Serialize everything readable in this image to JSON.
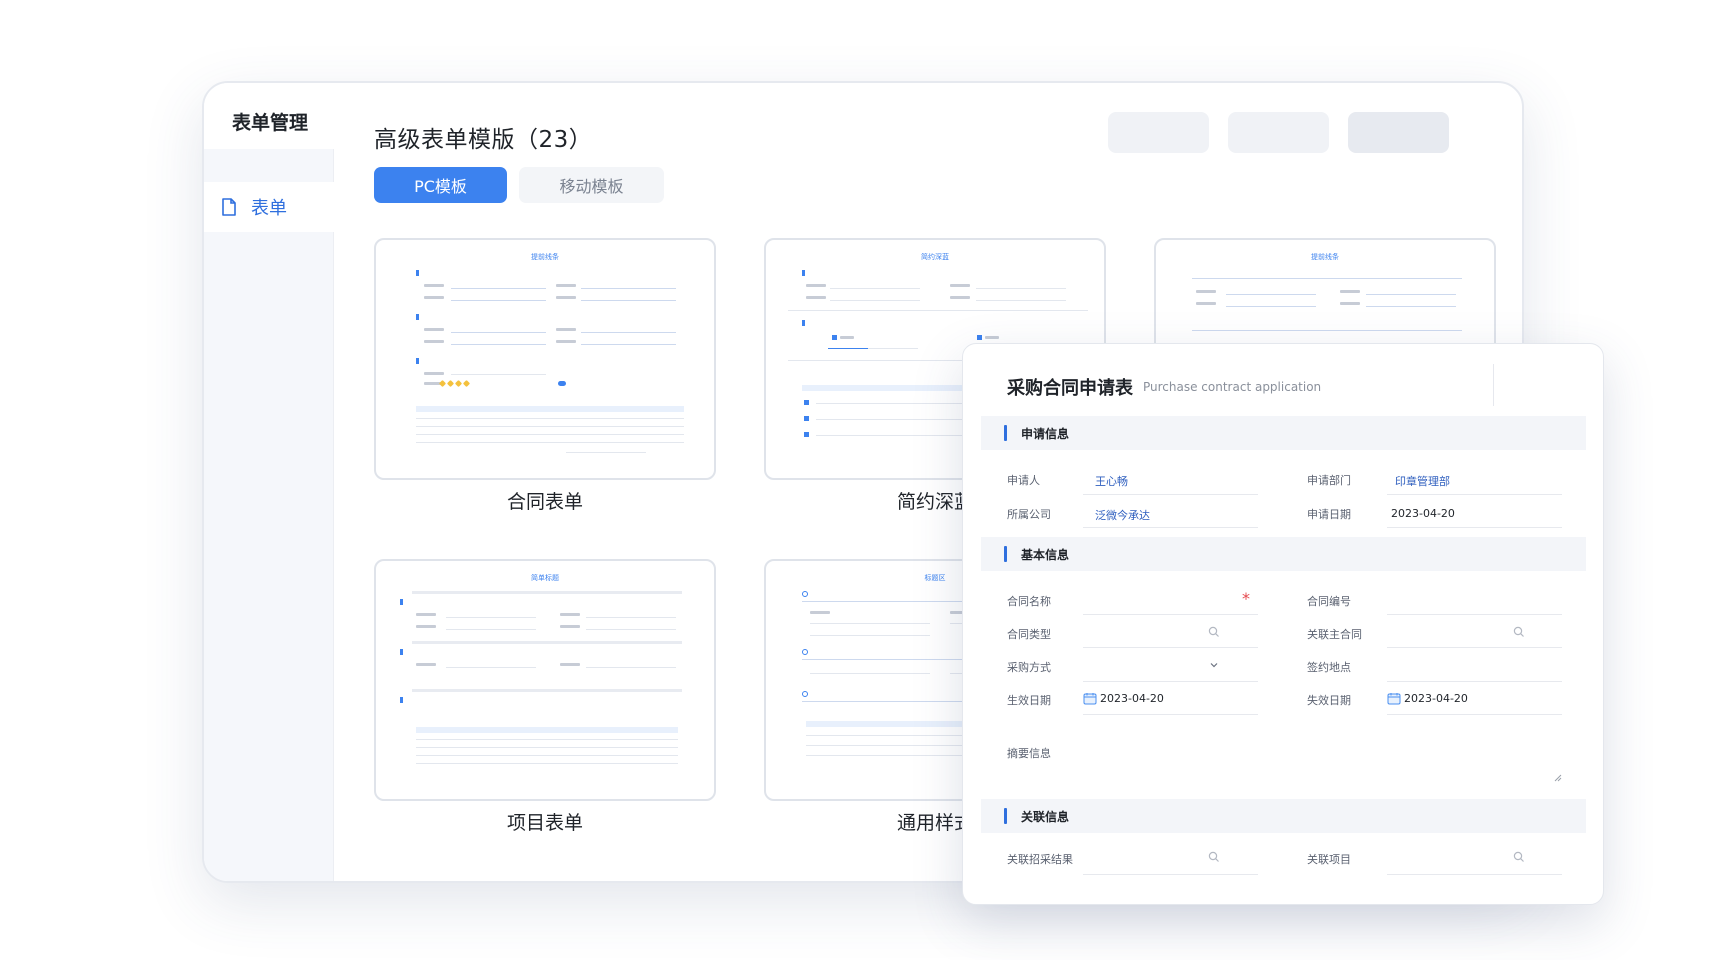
{
  "sidebar": {
    "title": "表单管理",
    "items": [
      {
        "label": "表单",
        "icon": "file-icon"
      }
    ]
  },
  "header": {
    "title": "高级表单模版（23）"
  },
  "tabs": [
    {
      "label": "PC模板",
      "active": true
    },
    {
      "label": "移动模板",
      "active": false
    }
  ],
  "templates": [
    {
      "label": "合同表单",
      "thumb_title": "提前线条"
    },
    {
      "label": "简约深蓝",
      "thumb_title": "简约深蓝"
    },
    {
      "label": "",
      "thumb_title": "提前线条"
    },
    {
      "label": "项目表单",
      "thumb_title": "简单标题"
    },
    {
      "label": "通用样式",
      "thumb_title": "标题区"
    }
  ],
  "form": {
    "title": "采购合同申请表",
    "subtitle": "Purchase contract application",
    "sections": {
      "apply": "申请信息",
      "basic": "基本信息",
      "related": "关联信息"
    },
    "fields": {
      "applicant": {
        "label": "申请人",
        "value": "王心畅"
      },
      "department": {
        "label": "申请部门",
        "value": "印章管理部"
      },
      "company": {
        "label": "所属公司",
        "value": "泛微今承达"
      },
      "apply_date": {
        "label": "申请日期",
        "value": "2023-04-20"
      },
      "contract_name": {
        "label": "合同名称",
        "value": ""
      },
      "contract_no": {
        "label": "合同编号",
        "value": ""
      },
      "contract_type": {
        "label": "合同类型",
        "value": ""
      },
      "main_contract": {
        "label": "关联主合同",
        "value": ""
      },
      "purchase_method": {
        "label": "采购方式",
        "value": ""
      },
      "sign_place": {
        "label": "签约地点",
        "value": ""
      },
      "effective_date": {
        "label": "生效日期",
        "value": "2023-04-20"
      },
      "expire_date": {
        "label": "失效日期",
        "value": "2023-04-20"
      },
      "summary": {
        "label": "摘要信息",
        "value": ""
      },
      "bid_result": {
        "label": "关联招采结果",
        "value": ""
      },
      "project": {
        "label": "关联项目",
        "value": ""
      }
    }
  },
  "colors": {
    "accent": "#3c82ef",
    "required": "#e5484d"
  }
}
